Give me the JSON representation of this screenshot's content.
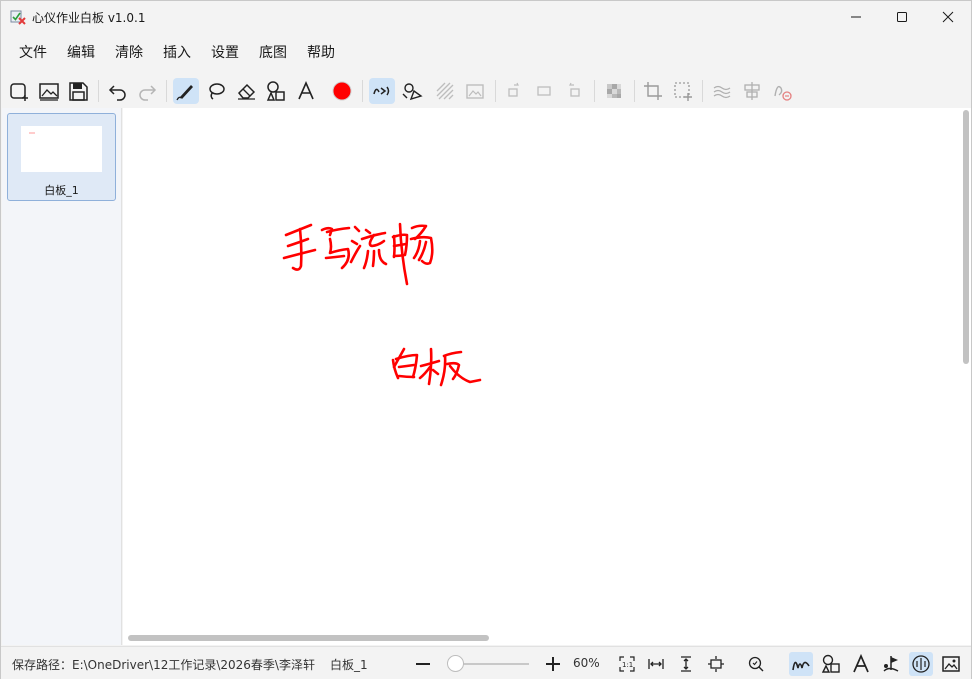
{
  "window": {
    "title": "心仪作业白板 v1.0.1",
    "icons": {
      "app": "app-logo-icon",
      "minimize": "minimize-icon",
      "maximize": "maximize-icon",
      "close": "close-icon"
    }
  },
  "menu": {
    "items": [
      "文件",
      "编辑",
      "清除",
      "插入",
      "设置",
      "底图",
      "帮助"
    ]
  },
  "toolbar": {
    "tools": [
      {
        "name": "new-board",
        "icon": "new-board-icon",
        "active": false,
        "enabled": true
      },
      {
        "name": "open-image",
        "icon": "image-icon",
        "active": false,
        "enabled": true
      },
      {
        "name": "save",
        "icon": "save-icon",
        "active": false,
        "enabled": true
      },
      {
        "name": "undo",
        "icon": "undo-icon",
        "active": false,
        "enabled": true
      },
      {
        "name": "redo",
        "icon": "redo-icon",
        "active": false,
        "enabled": false
      },
      {
        "name": "pen",
        "icon": "pen-icon",
        "active": true,
        "enabled": true
      },
      {
        "name": "lasso",
        "icon": "lasso-icon",
        "active": false,
        "enabled": true
      },
      {
        "name": "eraser",
        "icon": "eraser-icon",
        "active": false,
        "enabled": true
      },
      {
        "name": "shapes",
        "icon": "shapes-icon",
        "active": false,
        "enabled": true
      },
      {
        "name": "text",
        "icon": "text-icon",
        "active": false,
        "enabled": true
      },
      {
        "name": "color",
        "icon": "color-swatch-icon",
        "active": false,
        "enabled": true
      },
      {
        "name": "smooth-ink",
        "icon": "smooth-ink-icon",
        "active": true,
        "enabled": true
      },
      {
        "name": "shape-recognize",
        "icon": "shape-recognize-icon",
        "active": false,
        "enabled": true
      },
      {
        "name": "hatch",
        "icon": "hatch-icon",
        "active": false,
        "enabled": false
      },
      {
        "name": "background",
        "icon": "background-icon",
        "active": false,
        "enabled": false
      },
      {
        "name": "rotate-right",
        "icon": "rotate-right-icon",
        "active": false,
        "enabled": false
      },
      {
        "name": "flip",
        "icon": "flip-icon",
        "active": false,
        "enabled": false
      },
      {
        "name": "rotate-left",
        "icon": "rotate-left-icon",
        "active": false,
        "enabled": false
      },
      {
        "name": "mosaic",
        "icon": "mosaic-icon",
        "active": false,
        "enabled": false
      },
      {
        "name": "crop",
        "icon": "crop-icon",
        "active": false,
        "enabled": false
      },
      {
        "name": "select-region",
        "icon": "select-region-icon",
        "active": false,
        "enabled": false
      },
      {
        "name": "handwriting-blur",
        "icon": "blur-icon",
        "active": false,
        "enabled": false
      },
      {
        "name": "align",
        "icon": "align-icon",
        "active": false,
        "enabled": false
      },
      {
        "name": "signature",
        "icon": "signature-icon",
        "active": false,
        "enabled": false
      }
    ],
    "pen_color": "#ff0000"
  },
  "sidebar": {
    "boards": [
      {
        "label": "白板_1"
      }
    ]
  },
  "canvas": {
    "ink_color": "#ff0000"
  },
  "status": {
    "path": "保存路径：E:\\OneDriver\\12工作记录\\2026春季\\李泽轩",
    "board": "白板_1",
    "zoom": "60%",
    "zoom_fraction": 0.05,
    "icons": [
      "zoom-out-icon",
      "zoom-in-icon",
      "actual-size-icon",
      "fit-width-icon",
      "fit-height-icon",
      "fit-page-icon",
      "zoom-search-icon",
      "handwriting-layer-icon",
      "shape-layer-icon",
      "text-layer-icon",
      "flag-layer-icon",
      "reading-layer-icon",
      "image-layer-icon"
    ]
  },
  "accent": "#1a73e8"
}
